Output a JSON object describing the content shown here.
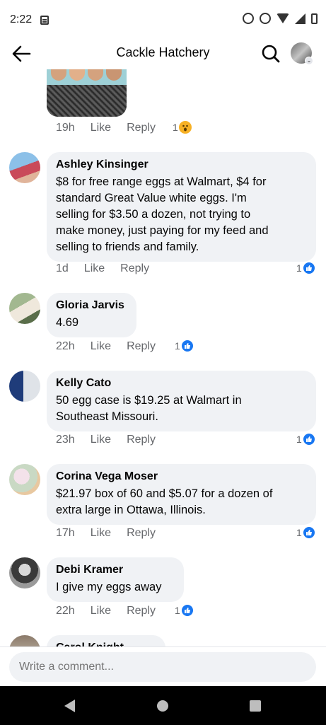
{
  "status_bar": {
    "time": "2:22",
    "icons": [
      "notification-icon",
      "alarm-icon",
      "sync-icon",
      "wifi-icon",
      "signal-icon",
      "battery-icon"
    ]
  },
  "header": {
    "title": "Cackle Hatchery",
    "back_icon": "arrow-left-icon",
    "search_icon": "search-icon",
    "profile_icon": "profile-avatar"
  },
  "top_comment_actions": {
    "time": "19h",
    "like": "Like",
    "reply": "Reply",
    "reaction_count": "1",
    "reaction_type": "wow"
  },
  "comments": [
    {
      "author": "Ashley Kinsinger",
      "text": "$8 for free range eggs at Walmart, $4 for standard Great Value white eggs. I'm selling for $3.50 a dozen, not trying to make money, just paying for my feed and selling to friends and family.",
      "lines": [
        "$8 for free range eggs at Walmart, $4 for",
        "standard Great Value white eggs. I'm",
        "selling for $3.50 a dozen, not trying to",
        "make money, just paying for my feed and",
        "selling to friends and family."
      ],
      "time": "1d",
      "like": "Like",
      "reply": "Reply",
      "reaction_count": "1",
      "reaction_type": "like"
    },
    {
      "author": "Gloria Jarvis",
      "text": "4.69",
      "lines": [
        "4.69"
      ],
      "time": "22h",
      "like": "Like",
      "reply": "Reply",
      "reaction_count": "1",
      "reaction_type": "like"
    },
    {
      "author": "Kelly Cato",
      "text": "50 egg case is $19.25 at Walmart in Southeast Missouri.",
      "lines": [
        "50 egg case is $19.25 at Walmart in",
        "Southeast Missouri."
      ],
      "time": "23h",
      "like": "Like",
      "reply": "Reply",
      "reaction_count": "1",
      "reaction_type": "like"
    },
    {
      "author": "Corina Vega Moser",
      "text": "$21.97 box of 60 and $5.07 for a dozen of extra large in Ottawa, Illinois.",
      "lines": [
        "$21.97 box of 60 and $5.07 for a dozen of",
        "extra large in Ottawa, Illinois."
      ],
      "time": "17h",
      "like": "Like",
      "reply": "Reply",
      "reaction_count": "1",
      "reaction_type": "like"
    },
    {
      "author": "Debi Kramer",
      "text": "I give my eggs away",
      "lines": [
        "I give my eggs away"
      ],
      "time": "22h",
      "like": "Like",
      "reply": "Reply",
      "reaction_count": "1",
      "reaction_type": "like"
    },
    {
      "author": "Carol Knight",
      "text": "",
      "lines": [],
      "time": "",
      "like": "",
      "reply": "",
      "reaction_count": "",
      "reaction_type": ""
    }
  ],
  "composer": {
    "placeholder": "Write a comment..."
  },
  "nav_bar": {
    "icons": [
      "back-nav-icon",
      "home-nav-icon",
      "recents-nav-icon"
    ]
  },
  "colors": {
    "bubble_bg": "#f0f2f5",
    "meta_text": "#65676b",
    "like_blue": "#1877f2",
    "wow_yellow": "#f7b125"
  }
}
